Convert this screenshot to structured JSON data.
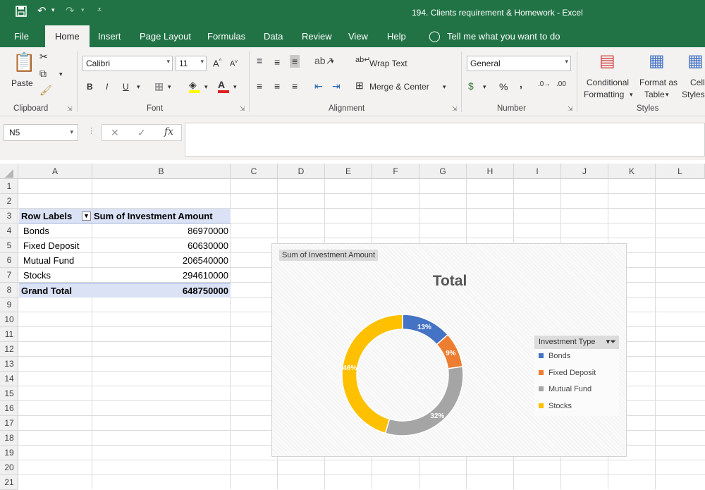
{
  "window": {
    "title": "194. Clients requirement & Homework  -  Excel"
  },
  "menu": {
    "tabs": [
      "File",
      "Home",
      "Insert",
      "Page Layout",
      "Formulas",
      "Data",
      "Review",
      "View",
      "Help"
    ],
    "tell_me": "Tell me what you want to do"
  },
  "ribbon": {
    "clipboard": {
      "paste": "Paste",
      "label": "Clipboard"
    },
    "font": {
      "name": "Calibri",
      "size": "11",
      "label": "Font",
      "bold": "B",
      "italic": "I",
      "underline": "U"
    },
    "alignment": {
      "wrap": "Wrap Text",
      "merge": "Merge & Center",
      "label": "Alignment"
    },
    "number": {
      "format": "General",
      "percent": "%",
      "comma": ",",
      "label": "Number"
    },
    "styles": {
      "conditional_1": "Conditional",
      "conditional_2": "Formatting",
      "format_table_1": "Format as",
      "format_table_2": "Table",
      "cell_1": "Cell",
      "cell_2": "Styles",
      "label": "Styles"
    }
  },
  "formula_bar": {
    "name_box": "N5",
    "fx": "fx",
    "formula": ""
  },
  "sheet": {
    "columns": [
      "A",
      "B",
      "C",
      "D",
      "E",
      "F",
      "G",
      "H",
      "I",
      "J",
      "K",
      "L"
    ],
    "rows": [
      "1",
      "2",
      "3",
      "4",
      "5",
      "6",
      "7",
      "8",
      "9",
      "10",
      "11",
      "12",
      "13",
      "14",
      "15",
      "16",
      "17",
      "18",
      "19",
      "20",
      "21"
    ],
    "pivot": {
      "header_row_labels": "Row Labels",
      "header_sum": "Sum of  Investment Amount",
      "items": [
        {
          "label": "Bonds",
          "value": "86970000"
        },
        {
          "label": "Fixed Deposit",
          "value": "60630000"
        },
        {
          "label": "Mutual Fund",
          "value": "206540000"
        },
        {
          "label": "Stocks",
          "value": "294610000"
        }
      ],
      "grand_total_label": "Grand Total",
      "grand_total_value": "648750000"
    }
  },
  "chart_data": {
    "type": "pie",
    "title": "Total",
    "field_button": "Sum of  Investment Amount",
    "legend_title": "Investment Type",
    "legend_position": "right",
    "donut": true,
    "categories": [
      "Bonds",
      "Fixed Deposit",
      "Mutual Fund",
      "Stocks"
    ],
    "values": [
      86970000,
      60630000,
      206540000,
      294610000
    ],
    "data_labels": [
      "13%",
      "9%",
      "32%",
      "46%"
    ],
    "colors": [
      "#4472c4",
      "#ed7d31",
      "#a5a5a5",
      "#ffc000"
    ]
  }
}
